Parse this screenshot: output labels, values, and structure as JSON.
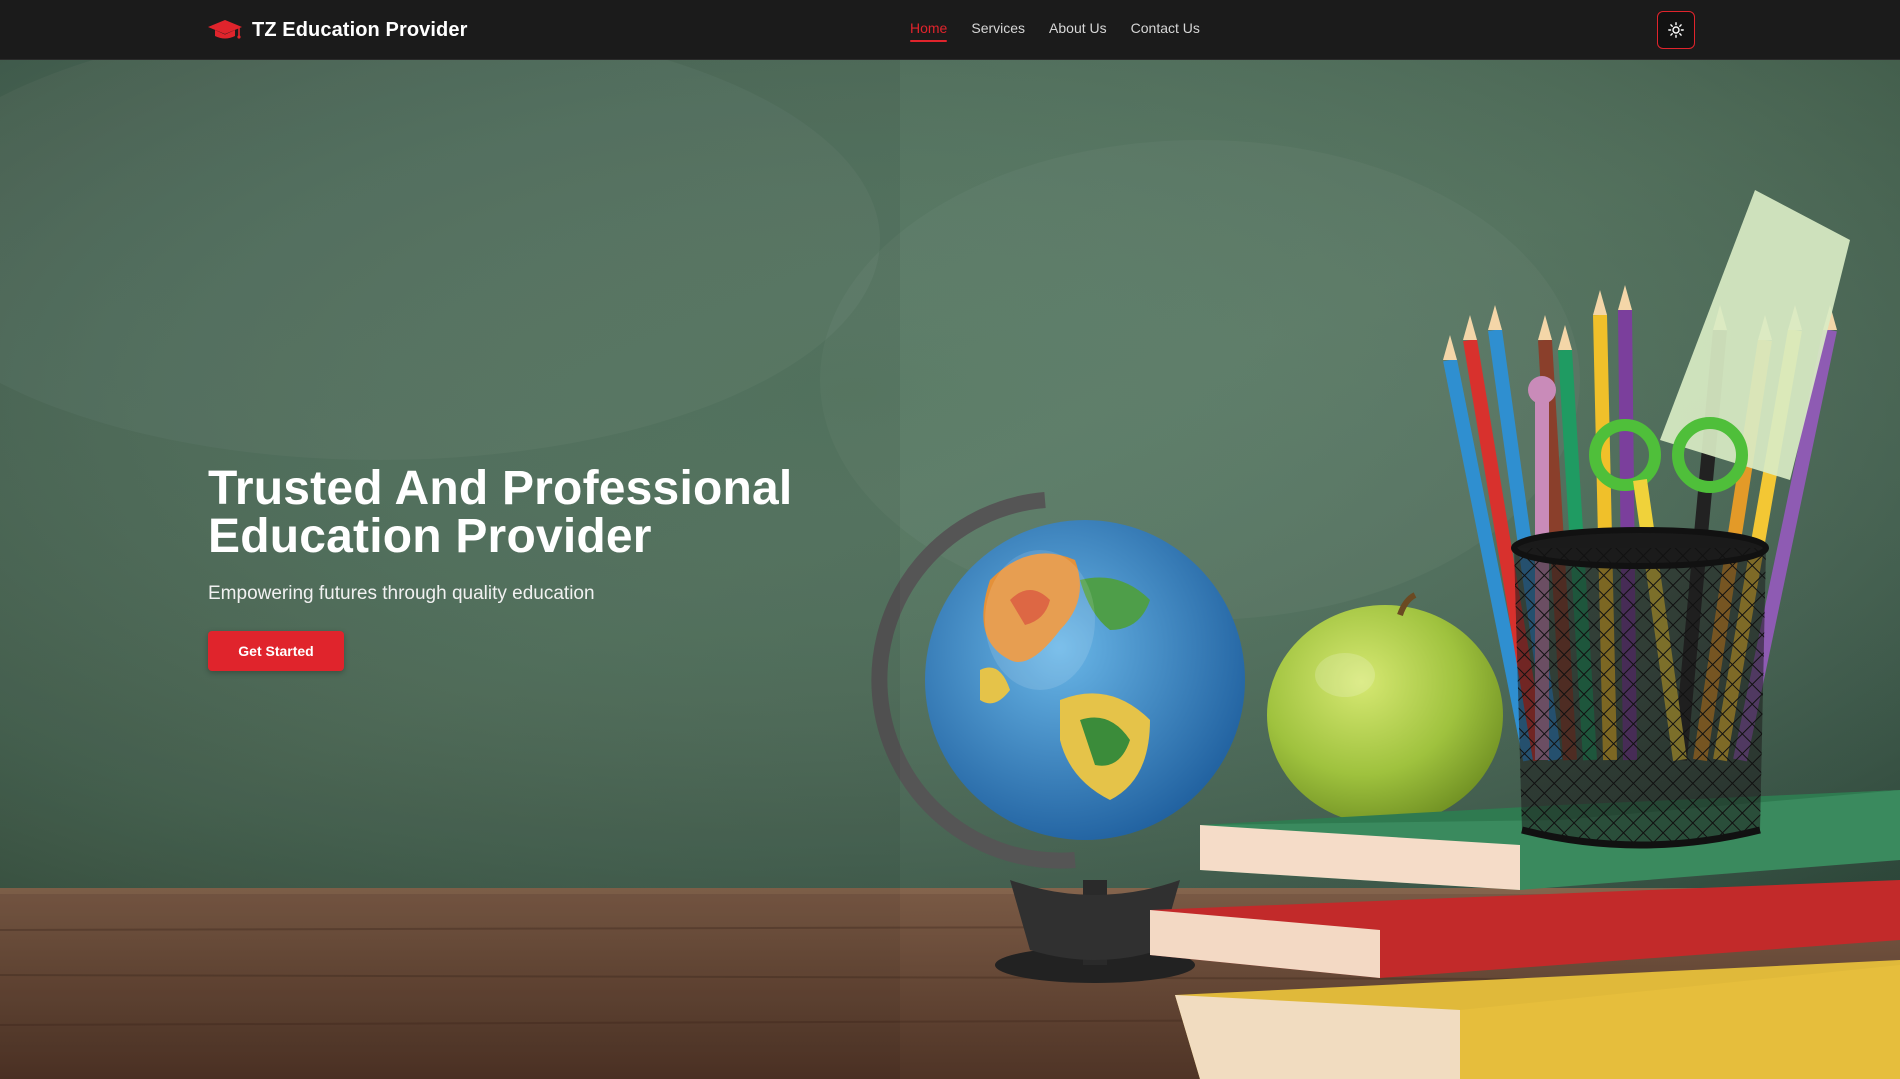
{
  "brand": {
    "name": "TZ Education Provider",
    "icon": "graduation-cap-icon",
    "accent_color": "#e0242c"
  },
  "nav": {
    "links": [
      {
        "label": "Home",
        "active": true
      },
      {
        "label": "Services",
        "active": false
      },
      {
        "label": "About Us",
        "active": false
      },
      {
        "label": "Contact Us",
        "active": false
      }
    ],
    "theme_toggle_icon": "sun-icon"
  },
  "hero": {
    "title": "Trusted And Professional Education Provider",
    "subtitle": "Empowering futures through quality education",
    "cta_label": "Get Started",
    "background_color": "#4b6c55"
  }
}
